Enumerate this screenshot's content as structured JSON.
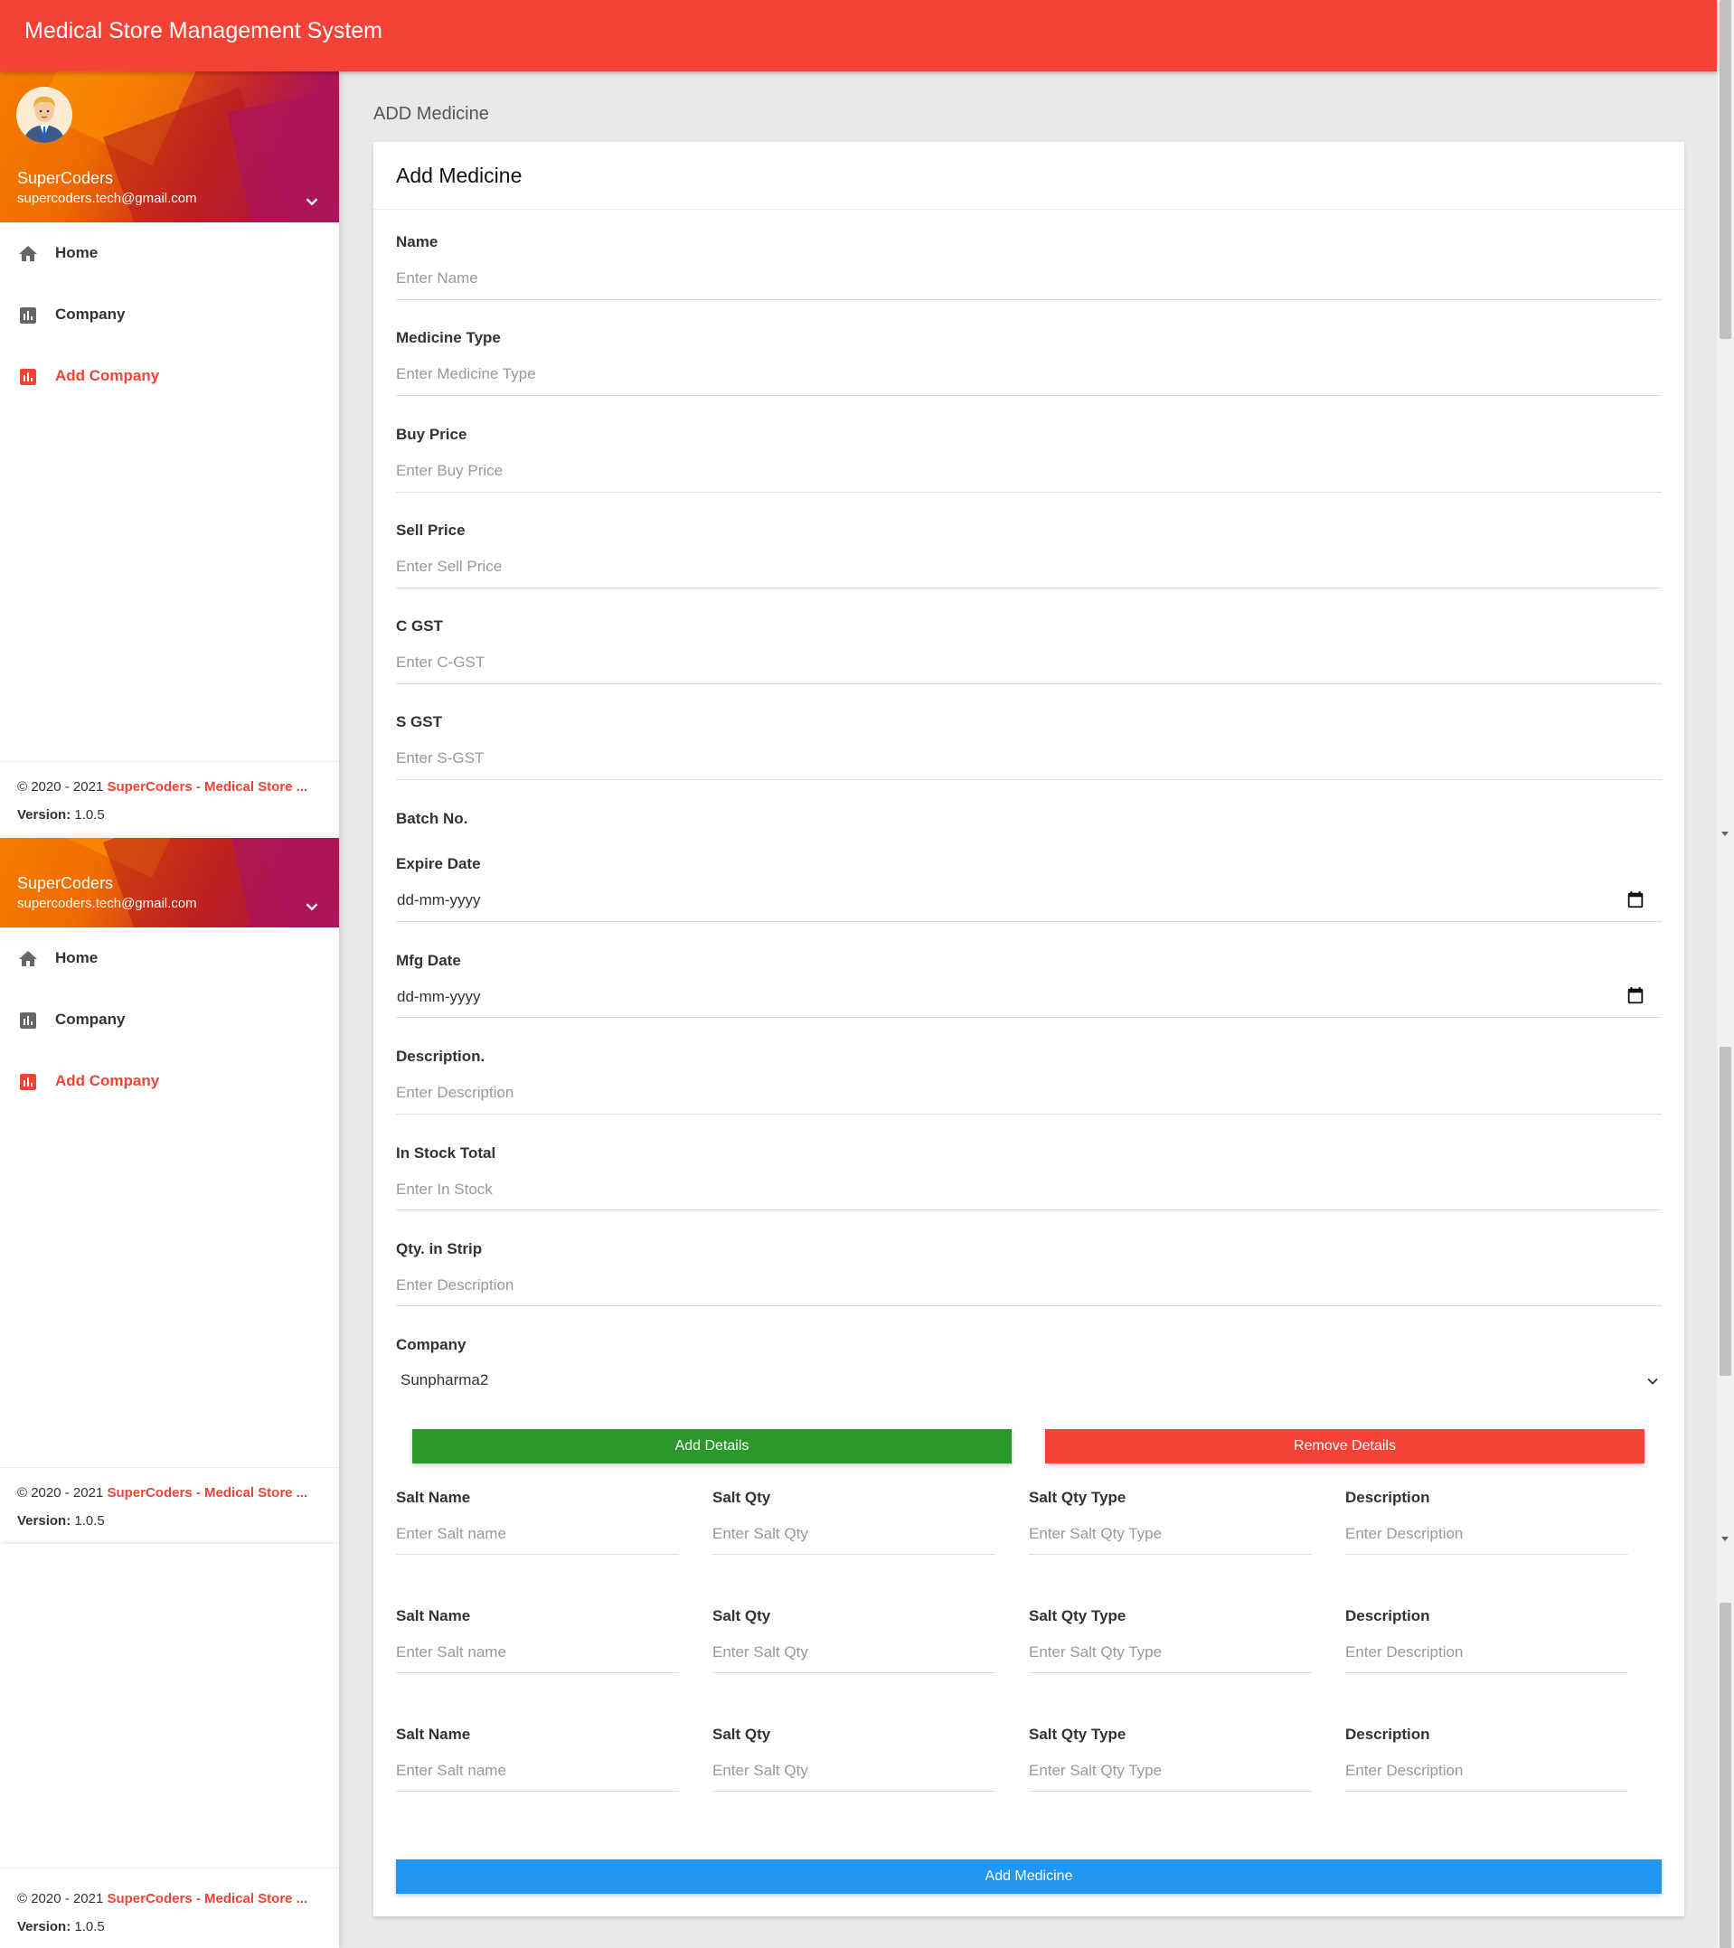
{
  "app": {
    "title": "Medical Store Management System"
  },
  "user": {
    "name": "SuperCoders",
    "email": "supercoders.tech@gmail.com"
  },
  "menu": [
    {
      "label": "Home",
      "icon": "home-icon",
      "active": false
    },
    {
      "label": "Company",
      "icon": "bar-chart-icon",
      "active": false
    },
    {
      "label": "Add Company",
      "icon": "bar-chart-icon",
      "active": true
    }
  ],
  "footer": {
    "copyright_prefix": "© 2020 - 2021 ",
    "brand": "SuperCoders - Medical Store ...",
    "version_label": "Version:",
    "version": " 1.0.5"
  },
  "page": {
    "heading": "ADD Medicine",
    "card_title": "Add Medicine"
  },
  "form": {
    "name": {
      "label": "Name",
      "placeholder": "Enter Name"
    },
    "medicine_type": {
      "label": "Medicine Type",
      "placeholder": "Enter Medicine Type"
    },
    "buy_price": {
      "label": "Buy Price",
      "placeholder": "Enter Buy Price"
    },
    "sell_price": {
      "label": "Sell Price",
      "placeholder": "Enter Sell Price"
    },
    "c_gst": {
      "label": "C GST",
      "placeholder": "Enter C-GST"
    },
    "s_gst": {
      "label": "S GST",
      "placeholder": "Enter S-GST"
    },
    "batch_no": {
      "label": "Batch No."
    },
    "expire_date": {
      "label": "Expire Date",
      "value": "dd-mm-yyyy"
    },
    "mfg_date": {
      "label": "Mfg Date",
      "value": "dd-mm-yyyy"
    },
    "description": {
      "label": "Description.",
      "placeholder": "Enter Description"
    },
    "in_stock": {
      "label": "In Stock Total",
      "placeholder": "Enter In Stock"
    },
    "qty_strip": {
      "label": "Qty. in Strip",
      "placeholder": "Enter Description"
    },
    "company": {
      "label": "Company",
      "value": "Sunpharma2"
    }
  },
  "buttons": {
    "add_details": "Add Details",
    "remove_details": "Remove Details",
    "submit": "Add Medicine"
  },
  "salt": {
    "labels": {
      "name": "Salt Name",
      "qty": "Salt Qty",
      "qty_type": "Salt Qty Type",
      "description": "Description"
    },
    "placeholders": {
      "name": "Enter Salt name",
      "qty": "Enter Salt Qty",
      "qty_type": "Enter Salt Qty Type",
      "description": "Enter Description"
    }
  },
  "colors": {
    "primary": "#f44336",
    "success": "#2b982b",
    "info": "#2196f3"
  }
}
